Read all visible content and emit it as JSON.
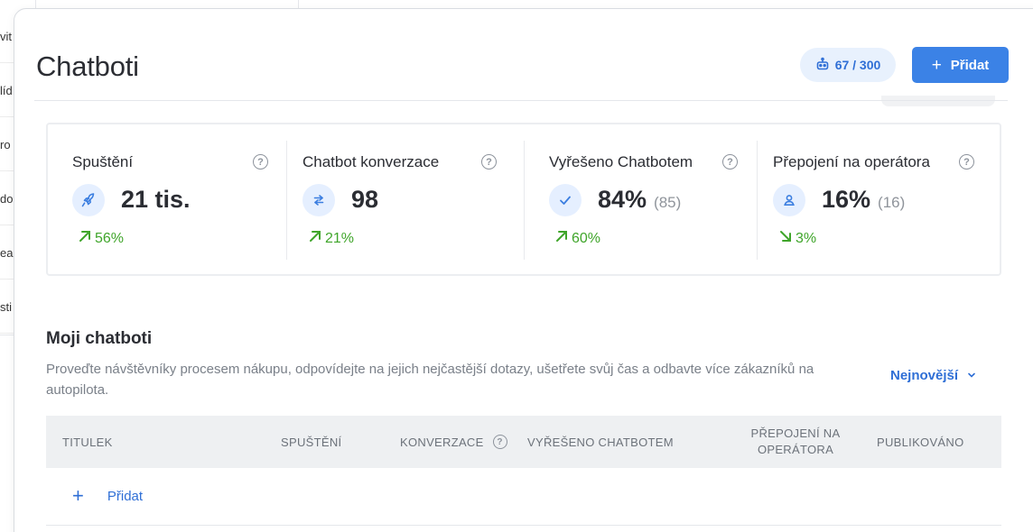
{
  "background_sidebar": {
    "items": [
      "vit",
      "líd",
      "ro",
      "do",
      "ea",
      "sti"
    ]
  },
  "page": {
    "title": "Chatboti",
    "usage": "67 / 300",
    "add_label": "Přidat"
  },
  "stats": [
    {
      "label": "Spuštění",
      "value": "21 tis.",
      "sub": "",
      "trend": "56%",
      "trend_dir": "up",
      "icon": "rocket-icon"
    },
    {
      "label": "Chatbot konverzace",
      "value": "98",
      "sub": "",
      "trend": "21%",
      "trend_dir": "up",
      "icon": "arrows-swap-icon"
    },
    {
      "label": "Vyřešeno Chatbotem",
      "value": "84%",
      "sub": "(85)",
      "trend": "60%",
      "trend_dir": "up",
      "icon": "check-icon"
    },
    {
      "label": "Přepojení na operátora",
      "value": "16%",
      "sub": "(16)",
      "trend": "3%",
      "trend_dir": "down",
      "icon": "person-icon"
    }
  ],
  "section": {
    "title": "Moji chatboti",
    "description": "Proveďte návštěvníky procesem nákupu, odpovídejte na jejich nejčastější dotazy, ušetřete svůj čas a odbavte více zákazníků na autopilota.",
    "sort_label": "Nejnovější"
  },
  "table": {
    "columns": [
      "TITULEK",
      "SPUŠTĚNÍ",
      "KONVERZACE",
      "VYŘEŠENO CHATBOTEM",
      "PŘEPOJENÍ NA OPERÁTORA",
      "PUBLIKOVÁNO"
    ],
    "add_row_label": "Přidat"
  },
  "colors": {
    "accent": "#3b82e6",
    "trend_up": "#3fa52a",
    "icon_bg": "#e5efff"
  }
}
